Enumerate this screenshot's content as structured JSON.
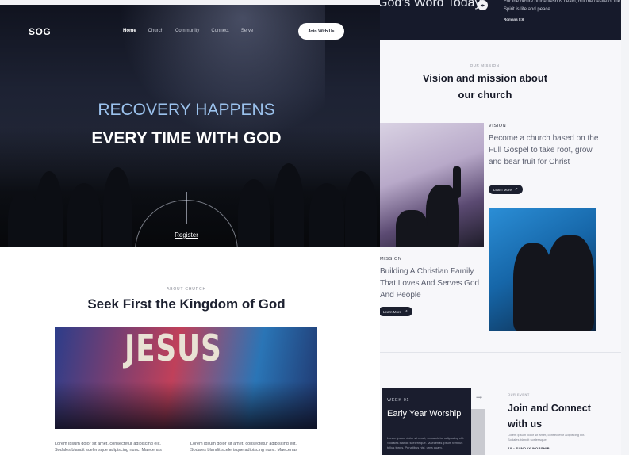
{
  "left": {
    "logo": "SOG",
    "nav": [
      "Home",
      "Church",
      "Community",
      "Connect",
      "Serve"
    ],
    "join_button": "Join With Us",
    "hero_line1": "RECOVERY HAPPENS",
    "hero_line2": "EVERY TIME WITH GOD",
    "register_link": "Register",
    "about_eyebrow": "ABOUT CHURCH",
    "about_title": "Seek First the Kingdom of God",
    "image_text": "JESUS",
    "lorem_col1": "Lorem ipsum dolor sit amet, consectetur adipiscing elit. Sodales blandit scelerisque adipiscing nunc. Maecenas",
    "lorem_col2": "Lorem ipsum dolor sit amet, consectetur adipiscing elit. Sodales blandit scelerisque adipiscing nunc. Maecenas"
  },
  "right": {
    "gods_word_title": "God's Word Today",
    "verse": "For the desire of the flesh is death, but the desire of the Spirit is life and peace",
    "verse_ref": "Romans 8:6",
    "mission_eyebrow": "OUR MISSION",
    "mission_title": "Vision and mission about our church",
    "vision_label": "VISION",
    "vision_text": "Become a church based on the Full Gospel to take root, grow and bear fruit for Christ",
    "learn_more": "Learn More",
    "mission_label": "MISSION",
    "mission_text": "Building A Christian Family That Loves And Serves God And People",
    "week_label": "WEEK 01",
    "week_title": "Early Year Worship",
    "week_desc": "Lorem ipsum dolor sit amet, consectetur adipiscing elit. Sodales blandit scelerisque. Maecenas ipsum tempus tellus turpis. Penatibus nisl, urna quam.",
    "event_eyebrow": "OUR EVENT",
    "event_title": "Join and Connect with us",
    "event_desc": "Lorem ipsum dolor sit amet, consectetur adipiscing elit. Sodales blandit scelerisque.",
    "event_meta": "4X • SUNDAY WORSHIP"
  }
}
